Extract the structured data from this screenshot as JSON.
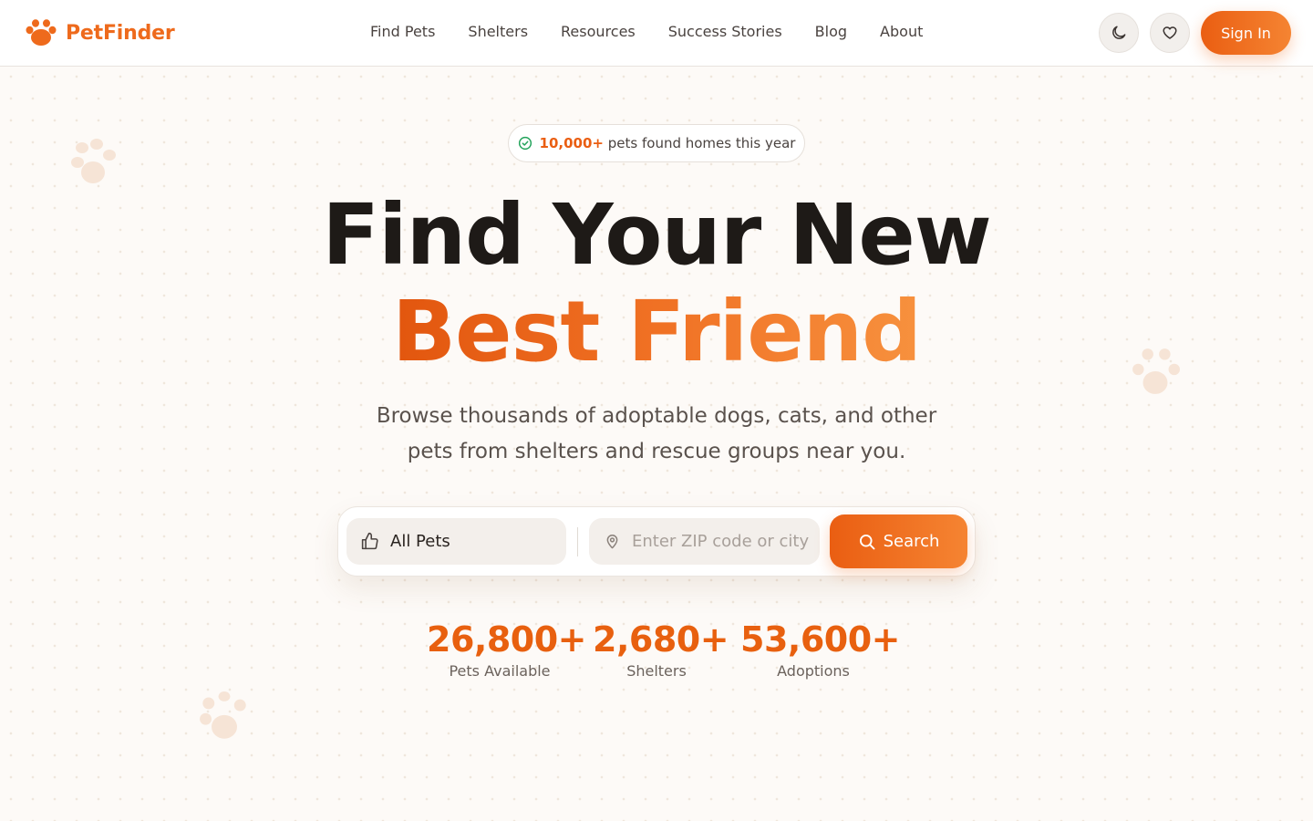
{
  "header": {
    "logo_text": "PetFinder",
    "nav": [
      "Find Pets",
      "Shelters",
      "Resources",
      "Success Stories",
      "Blog",
      "About"
    ],
    "sign_in_label": "Sign In"
  },
  "badge": {
    "highlight": "10,000+",
    "text": "pets found homes this year"
  },
  "hero": {
    "line1": "Find Your New",
    "line2": "Best Friend",
    "subtitle": "Browse thousands of adoptable dogs, cats, and other pets from shelters and rescue groups near you."
  },
  "search": {
    "pet_type_value": "All Pets",
    "location_placeholder": "Enter ZIP code or city",
    "button_label": "Search"
  },
  "stats": [
    {
      "value": "26,800+",
      "label": "Pets Available"
    },
    {
      "value": "2,680+",
      "label": "Shelters"
    },
    {
      "value": "53,600+",
      "label": "Adoptions"
    }
  ],
  "colors": {
    "accent": "#ee6a1c",
    "accent_light": "#f58432",
    "badge_check": "#22a35a"
  },
  "icons": {
    "logo": "paw-icon",
    "theme_toggle": "moon-icon",
    "favorites": "heart-icon",
    "badge": "check-circle-icon",
    "pet_type": "thumbs-up-icon",
    "location": "map-pin-icon",
    "search": "search-icon"
  }
}
